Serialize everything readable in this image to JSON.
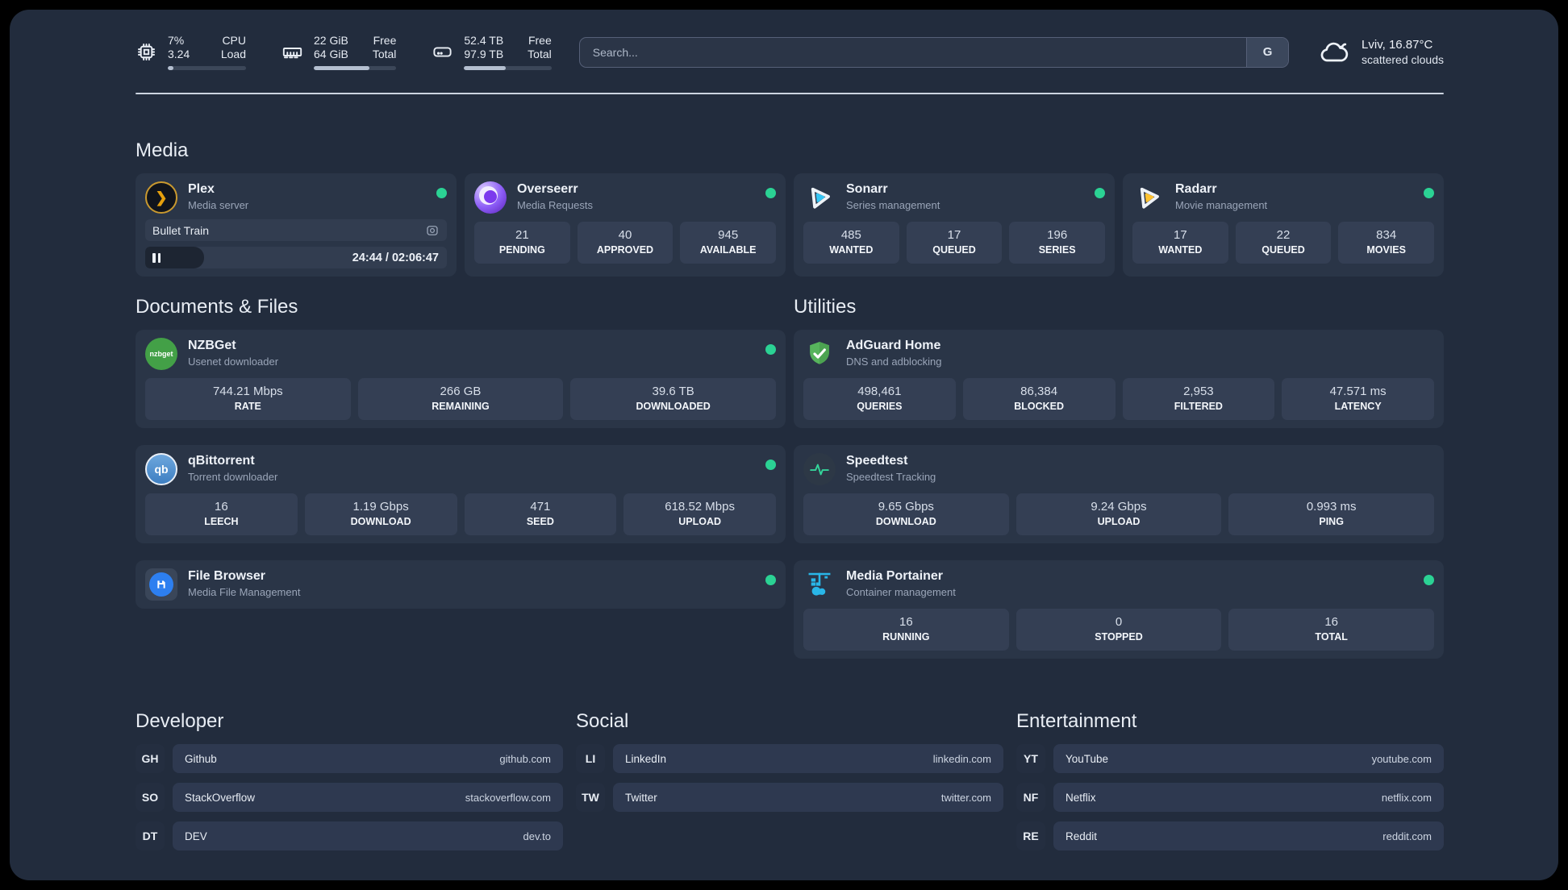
{
  "header": {
    "stats": {
      "cpu": {
        "v1": "7%",
        "v2": "3.24",
        "l1": "CPU",
        "l2": "Load",
        "pct": 7
      },
      "ram": {
        "v1": "22 GiB",
        "v2": "64 GiB",
        "l1": "Free",
        "l2": "Total",
        "pct": 67
      },
      "disk": {
        "v1": "52.4 TB",
        "v2": "97.9 TB",
        "l1": "Free",
        "l2": "Total",
        "pct": 48
      }
    },
    "search": {
      "placeholder": "Search...",
      "button_label": "G"
    },
    "weather": {
      "summary": "Lviv, 16.87°C",
      "detail": "scattered clouds"
    }
  },
  "media": {
    "title": "Media",
    "plex": {
      "name": "Plex",
      "desc": "Media server",
      "logo_glyph": "❯",
      "now_playing": "Bullet Train",
      "time": "24:44 / 02:06:47",
      "progress_pct": 19.5
    },
    "overseerr": {
      "name": "Overseerr",
      "desc": "Media Requests",
      "stats": [
        {
          "value": "21",
          "label": "PENDING"
        },
        {
          "value": "40",
          "label": "APPROVED"
        },
        {
          "value": "945",
          "label": "AVAILABLE"
        }
      ]
    },
    "sonarr": {
      "name": "Sonarr",
      "desc": "Series management",
      "stats": [
        {
          "value": "485",
          "label": "WANTED"
        },
        {
          "value": "17",
          "label": "QUEUED"
        },
        {
          "value": "196",
          "label": "SERIES"
        }
      ]
    },
    "radarr": {
      "name": "Radarr",
      "desc": "Movie management",
      "stats": [
        {
          "value": "17",
          "label": "WANTED"
        },
        {
          "value": "22",
          "label": "QUEUED"
        },
        {
          "value": "834",
          "label": "MOVIES"
        }
      ]
    }
  },
  "documents": {
    "title": "Documents & Files",
    "nzbget": {
      "name": "NZBGet",
      "desc": "Usenet downloader",
      "logo_text": "nzbget",
      "stats": [
        {
          "value": "744.21 Mbps",
          "label": "RATE"
        },
        {
          "value": "266 GB",
          "label": "REMAINING"
        },
        {
          "value": "39.6 TB",
          "label": "DOWNLOADED"
        }
      ]
    },
    "qbittorrent": {
      "name": "qBittorrent",
      "desc": "Torrent downloader",
      "logo_text": "qb",
      "stats": [
        {
          "value": "16",
          "label": "LEECH"
        },
        {
          "value": "1.19 Gbps",
          "label": "DOWNLOAD"
        },
        {
          "value": "471",
          "label": "SEED"
        },
        {
          "value": "618.52 Mbps",
          "label": "UPLOAD"
        }
      ]
    },
    "filebrowser": {
      "name": "File Browser",
      "desc": "Media File Management"
    }
  },
  "utilities": {
    "title": "Utilities",
    "adguard": {
      "name": "AdGuard Home",
      "desc": "DNS and adblocking",
      "stats": [
        {
          "value": "498,461",
          "label": "QUERIES"
        },
        {
          "value": "86,384",
          "label": "BLOCKED"
        },
        {
          "value": "2,953",
          "label": "FILTERED"
        },
        {
          "value": "47.571 ms",
          "label": "LATENCY"
        }
      ]
    },
    "speedtest": {
      "name": "Speedtest",
      "desc": "Speedtest Tracking",
      "stats": [
        {
          "value": "9.65 Gbps",
          "label": "DOWNLOAD"
        },
        {
          "value": "9.24 Gbps",
          "label": "UPLOAD"
        },
        {
          "value": "0.993 ms",
          "label": "PING"
        }
      ]
    },
    "portainer": {
      "name": "Media Portainer",
      "desc": "Container management",
      "stats": [
        {
          "value": "16",
          "label": "RUNNING"
        },
        {
          "value": "0",
          "label": "STOPPED"
        },
        {
          "value": "16",
          "label": "TOTAL"
        }
      ]
    }
  },
  "links": {
    "developer": {
      "title": "Developer",
      "items": [
        {
          "abbr": "GH",
          "name": "Github",
          "url": "github.com"
        },
        {
          "abbr": "SO",
          "name": "StackOverflow",
          "url": "stackoverflow.com"
        },
        {
          "abbr": "DT",
          "name": "DEV",
          "url": "dev.to"
        }
      ]
    },
    "social": {
      "title": "Social",
      "items": [
        {
          "abbr": "LI",
          "name": "LinkedIn",
          "url": "linkedin.com"
        },
        {
          "abbr": "TW",
          "name": "Twitter",
          "url": "twitter.com"
        }
      ]
    },
    "entertainment": {
      "title": "Entertainment",
      "items": [
        {
          "abbr": "YT",
          "name": "YouTube",
          "url": "youtube.com"
        },
        {
          "abbr": "NF",
          "name": "Netflix",
          "url": "netflix.com"
        },
        {
          "abbr": "RE",
          "name": "Reddit",
          "url": "reddit.com"
        }
      ]
    }
  }
}
